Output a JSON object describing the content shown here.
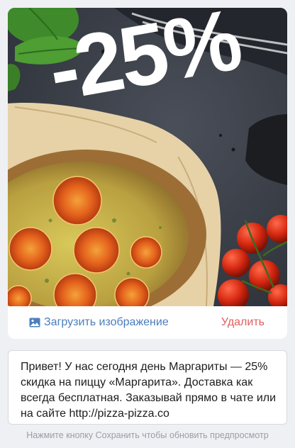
{
  "image_card": {
    "discount_label": "-25%",
    "upload_label": "Загрузить изображение",
    "delete_label": "Удалить",
    "upload_icon": "image-icon"
  },
  "message": {
    "text": "Привет! У нас сегодня день Маргариты — 25%\nскидка на пиццу «Маргарита». Доставка как\nвсегда бесплатная. Заказывай прямо в чате или\nна сайте http://pizza-pizza.co"
  },
  "hint": {
    "text": "Нажмите кнопку Сохранить чтобы обновить предпросмотр"
  },
  "colors": {
    "link_blue": "#4a7ebd",
    "delete_red": "#e0605e",
    "page_background": "#eef0f3"
  }
}
